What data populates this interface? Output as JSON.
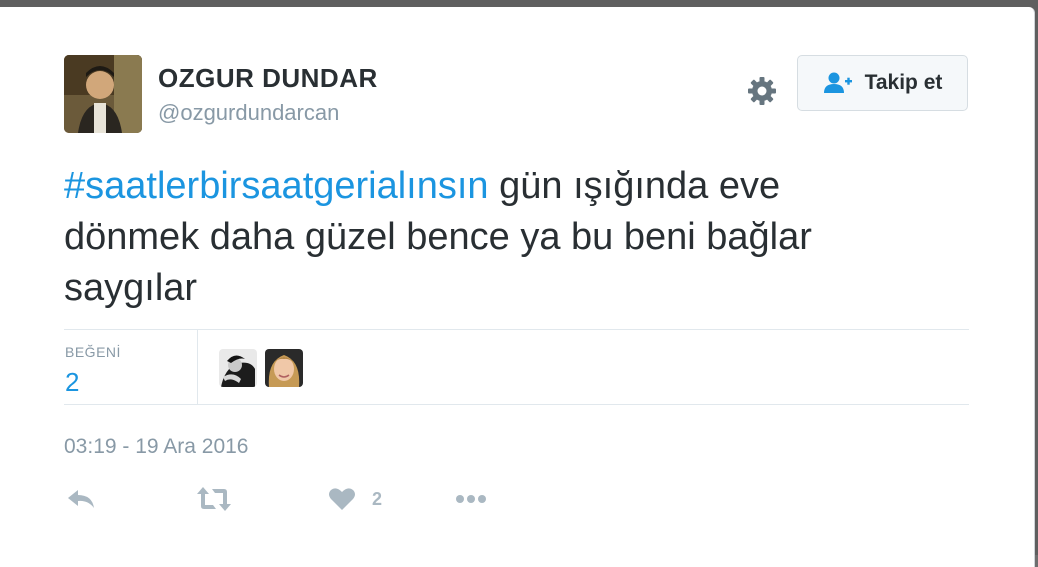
{
  "user": {
    "name": "OZGUR DUNDAR",
    "handle": "@ozgurdundarcan"
  },
  "follow_button": {
    "label": "Takip et",
    "icon": "add-user-icon"
  },
  "settings_icon": "gear-icon",
  "tweet": {
    "hashtag": "#saatlerbirsaatgerialınsın",
    "text_line1": " gün ışığında eve",
    "text_line2": "dönmek daha güzel bence ya bu beni bağlar",
    "text_line3": "saygılar"
  },
  "stats": {
    "likes_label": "BEĞENİ",
    "likes_count": "2"
  },
  "timestamp": "03:19 - 19 Ara 2016",
  "actions": {
    "reply_icon": "reply-icon",
    "retweet_icon": "retweet-icon",
    "like_icon": "heart-icon",
    "like_count": "2",
    "more_icon": "more-icon"
  },
  "colors": {
    "accent": "#1b95e0",
    "text": "#292f33",
    "muted": "#8899a6",
    "action_icon": "#aab8c2"
  }
}
